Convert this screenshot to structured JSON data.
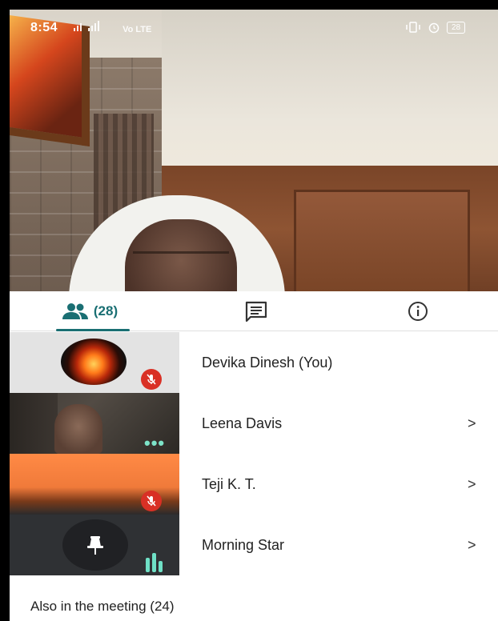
{
  "status_bar": {
    "time": "8:54",
    "signal_text": "Vo LTE",
    "battery": "28"
  },
  "tabs": {
    "people_count": "(28)",
    "active": "people"
  },
  "participants": [
    {
      "name": "Devika Dinesh (You)",
      "muted": true,
      "has_chevron": false
    },
    {
      "name": "Leena Davis",
      "muted": false,
      "has_chevron": true,
      "chevron": ">"
    },
    {
      "name": "Teji K. T.",
      "muted": true,
      "has_chevron": true,
      "chevron": ">"
    },
    {
      "name": "Morning Star",
      "muted": false,
      "has_chevron": true,
      "chevron": ">"
    }
  ],
  "also_in_meeting": "Also in the meeting (24)",
  "colors": {
    "accent": "#1a6f73",
    "mic_off": "#d93025",
    "speaking": "#6fe0c6"
  },
  "icons": [
    "people-icon",
    "chat-icon",
    "info-icon",
    "mic-off-icon",
    "more-dots-icon",
    "pin-icon",
    "audio-level-icon",
    "alarm-icon"
  ]
}
